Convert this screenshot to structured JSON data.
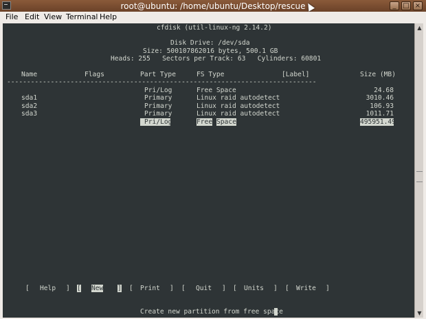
{
  "window": {
    "title": "root@ubuntu: /home/ubuntu/Desktop/rescue",
    "minimize_glyph": "_",
    "maximize_glyph": "□",
    "close_glyph": "×"
  },
  "menubar": {
    "items": [
      "File",
      "Edit",
      "View",
      "Terminal",
      "Help"
    ]
  },
  "terminal": {
    "header": "cfdisk (util-linux-ng 2.14.2)",
    "disk_drive": "Disk Drive: /dev/sda",
    "size_line": "Size: 500107862016 bytes, 500.1 GB",
    "geometry_line": "Heads: 255   Sectors per Track: 63   Cylinders: 60801",
    "columns": {
      "name": "Name",
      "flags": "Flags",
      "part_type": "Part Type",
      "fs_type": "FS Type",
      "label": "[Label]",
      "size": "Size (MB)"
    },
    "separator": "------------------------------------------------------------------------------",
    "rows": [
      {
        "name": "",
        "part_type": "Pri/Log",
        "fs_type": "Free Space",
        "size": "24.68"
      },
      {
        "name": "sda1",
        "part_type": "Primary",
        "fs_type": "Linux raid autodetect",
        "size": "3010.46"
      },
      {
        "name": "sda2",
        "part_type": "Primary",
        "fs_type": "Linux raid autodetect",
        "size": "106.93"
      },
      {
        "name": "sda3",
        "part_type": "Primary",
        "fs_type": "Linux raid autodetect",
        "size": "1011.71"
      },
      {
        "name": "",
        "part_type": "Pri/Log",
        "fs_type_a": "Free",
        "fs_type_b": "Space",
        "size": "495951.49",
        "selected": true
      }
    ],
    "commands": [
      {
        "label": "Help"
      },
      {
        "label": "New",
        "selected": true
      },
      {
        "label": "Print"
      },
      {
        "label": "Quit"
      },
      {
        "label": "Units"
      },
      {
        "label": "Write"
      }
    ],
    "status": "Create new partition from free space"
  },
  "colors": {
    "terminal_bg": "#2e3436",
    "terminal_fg": "#d3d7cf",
    "titlebar": "#7a4c30"
  }
}
